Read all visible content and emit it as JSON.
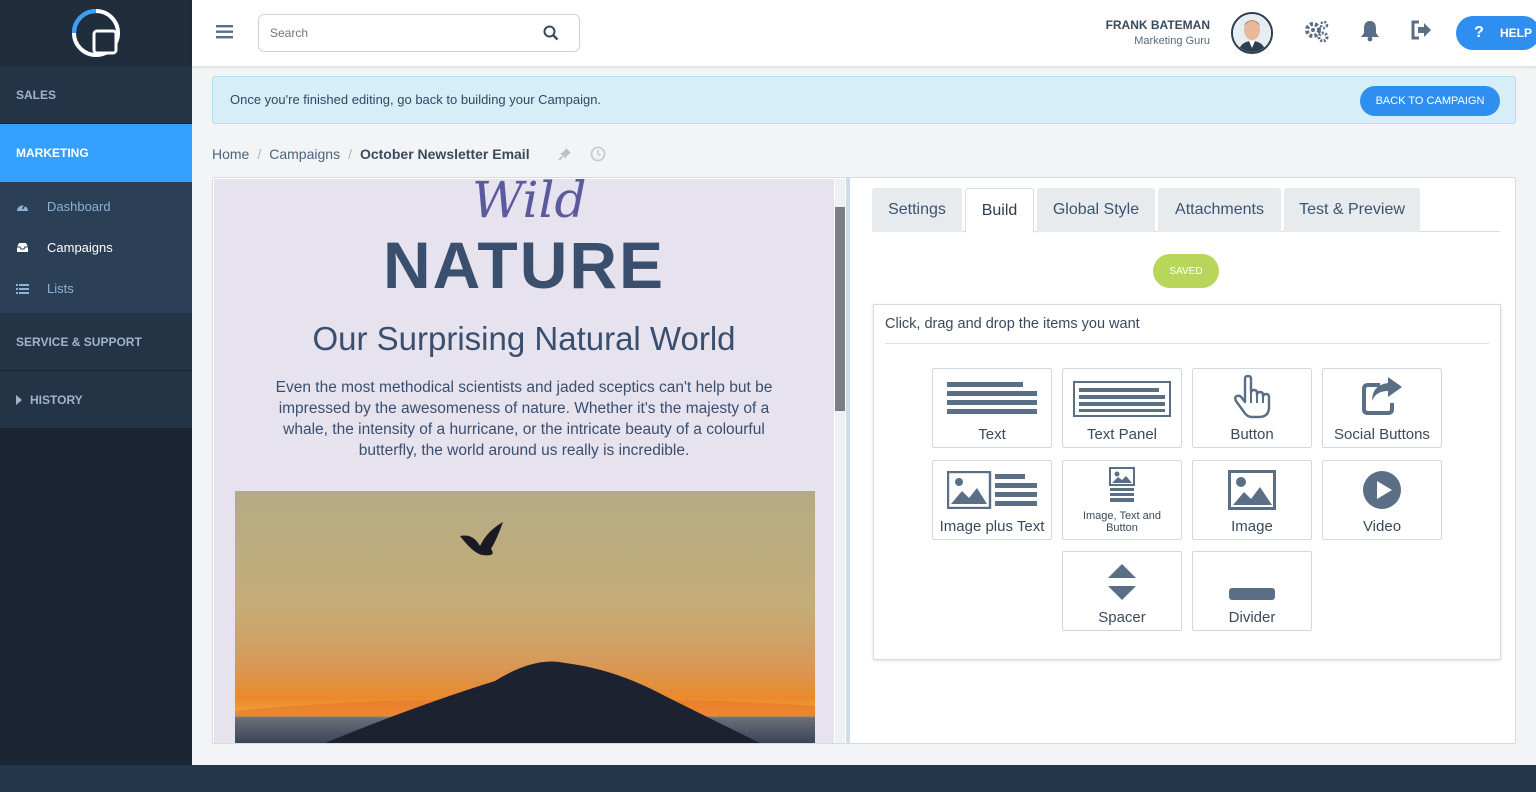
{
  "sidebar": {
    "sections": {
      "sales": "SALES",
      "marketing": "MARKETING",
      "service": "SERVICE & SUPPORT",
      "history": "HISTORY"
    },
    "marketing_items": [
      {
        "label": "Dashboard",
        "icon": "dashboard-icon"
      },
      {
        "label": "Campaigns",
        "icon": "inbox-icon"
      },
      {
        "label": "Lists",
        "icon": "list-icon"
      }
    ],
    "accent": "#35a0ff"
  },
  "header": {
    "search_placeholder": "Search",
    "user_name": "FRANK BATEMAN",
    "user_role": "Marketing Guru",
    "help_label": "HELP"
  },
  "banner": {
    "message": "Once you're finished editing, go back to building your Campaign.",
    "button": "BACK TO CAMPAIGN"
  },
  "breadcrumb": {
    "home": "Home",
    "campaigns": "Campaigns",
    "current": "October Newsletter Email"
  },
  "preview": {
    "logo_script": "Wild",
    "logo_title": "NATURE",
    "headline": "Our Surprising Natural World",
    "paragraph": "Even the most methodical scientists and jaded sceptics can't help but be impressed by the awesomeness of nature. Whether it's the majesty of a whale, the intensity of a hurricane, or the intricate beauty of a colourful butterfly, the world around us really is incredible."
  },
  "tabs": [
    "Settings",
    "Build",
    "Global Style",
    "Attachments",
    "Test & Preview"
  ],
  "active_tab": "Build",
  "status_badge": "SAVED",
  "palette": {
    "instruction": "Click, drag and drop the items you want",
    "blocks": [
      "Text",
      "Text Panel",
      "Button",
      "Social Buttons",
      "Image plus Text",
      "Image, Text and Button",
      "Image",
      "Video",
      "Spacer",
      "Divider"
    ]
  },
  "colors": {
    "primary": "#2f8ff0",
    "saved": "#b7d65a",
    "icon": "#5a6f86"
  }
}
